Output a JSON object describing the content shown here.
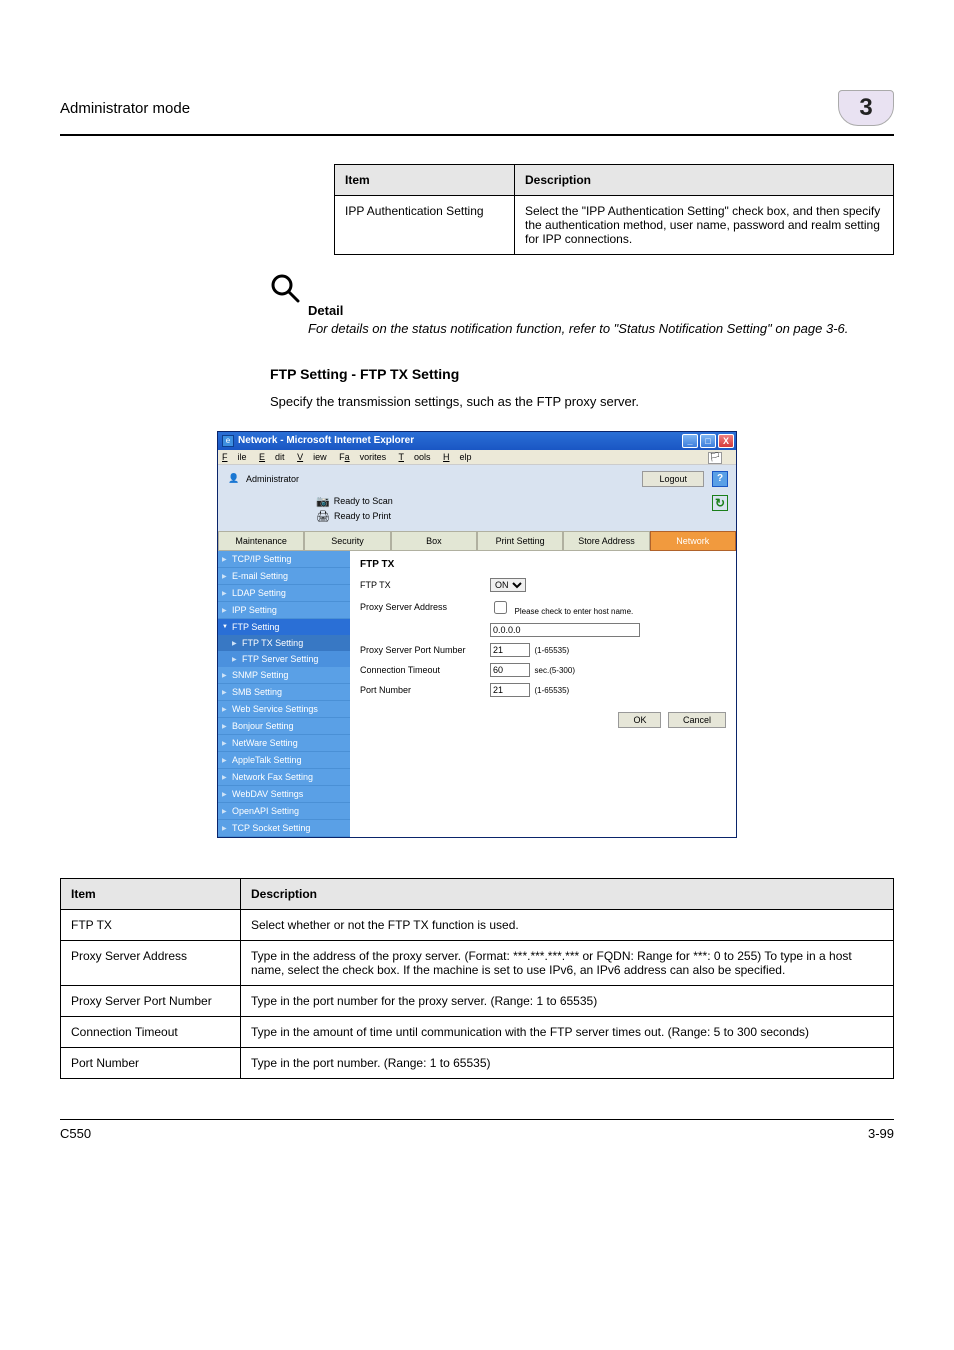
{
  "header": {
    "left": "Administrator mode",
    "chapter": "3"
  },
  "table1": {
    "h1": "Item",
    "h2": "Description",
    "rows": [
      {
        "c1": "IPP Authentication Setting",
        "c2": "Select the \"IPP Authentication Setting\" check box, and then specify the authentication method, user name, password and realm setting for IPP connections."
      }
    ]
  },
  "detail": {
    "title": "Detail",
    "body": "For details on the status notification function, refer to \"Status Notification Setting\" on page 3-6."
  },
  "section": {
    "heading": "FTP Setting - FTP TX Setting",
    "body": "Specify the transmission settings, such as the FTP proxy server."
  },
  "ie": {
    "title": "Network - Microsoft Internet Explorer",
    "menu": {
      "file": "File",
      "edit": "Edit",
      "view": "View",
      "favorites": "Favorites",
      "tools": "Tools",
      "help": "Help"
    },
    "admin": "Administrator",
    "logout": "Logout",
    "status_scan": "Ready to Scan",
    "status_print": "Ready to Print",
    "tabs": {
      "maintenance": "Maintenance",
      "security": "Security",
      "box": "Box",
      "print": "Print Setting",
      "store": "Store Address",
      "network": "Network"
    },
    "sidebar": {
      "items": [
        "TCP/IP Setting",
        "E-mail Setting",
        "LDAP Setting",
        "IPP Setting"
      ],
      "group": "FTP Setting",
      "subs": [
        "FTP TX Setting",
        "FTP Server Setting"
      ],
      "items2": [
        "SNMP Setting",
        "SMB Setting",
        "Web Service Settings",
        "Bonjour Setting",
        "NetWare Setting",
        "AppleTalk Setting",
        "Network Fax Setting",
        "WebDAV Settings",
        "OpenAPI Setting",
        "TCP Socket Setting"
      ]
    },
    "form": {
      "title": "FTP TX",
      "ftp_tx_label": "FTP TX",
      "ftp_tx_value": "ON",
      "proxy_addr_label": "Proxy Server Address",
      "proxy_addr_hint": "Please check to enter host name.",
      "proxy_addr_value": "0.0.0.0",
      "proxy_port_label": "Proxy Server Port Number",
      "proxy_port_value": "21",
      "proxy_port_range": "(1-65535)",
      "timeout_label": "Connection Timeout",
      "timeout_value": "60",
      "timeout_range": "sec.(5-300)",
      "port_label": "Port Number",
      "port_value": "21",
      "port_range": "(1-65535)",
      "ok": "OK",
      "cancel": "Cancel"
    }
  },
  "table2": {
    "h1": "Item",
    "h2": "Description",
    "rows": [
      {
        "c1": "FTP TX",
        "c2": "Select whether or not the FTP TX function is used."
      },
      {
        "c1": "Proxy Server Address",
        "c2": "Type in the address of the proxy server. (Format: ***.***.***.*** or FQDN: Range for ***: 0 to 255) To type in a host name, select the check box. If the machine is set to use IPv6, an IPv6 address can also be specified."
      },
      {
        "c1": "Proxy Server Port Number",
        "c2": "Type in the port number for the proxy server. (Range: 1 to 65535)"
      },
      {
        "c1": "Connection Timeout",
        "c2": "Type in the amount of time until communication with the FTP server times out. (Range: 5 to 300 seconds)"
      },
      {
        "c1": "Port Number",
        "c2": "Type in the port number. (Range: 1 to 65535)"
      }
    ]
  },
  "footer": {
    "left": "C550",
    "right": "3-99"
  }
}
